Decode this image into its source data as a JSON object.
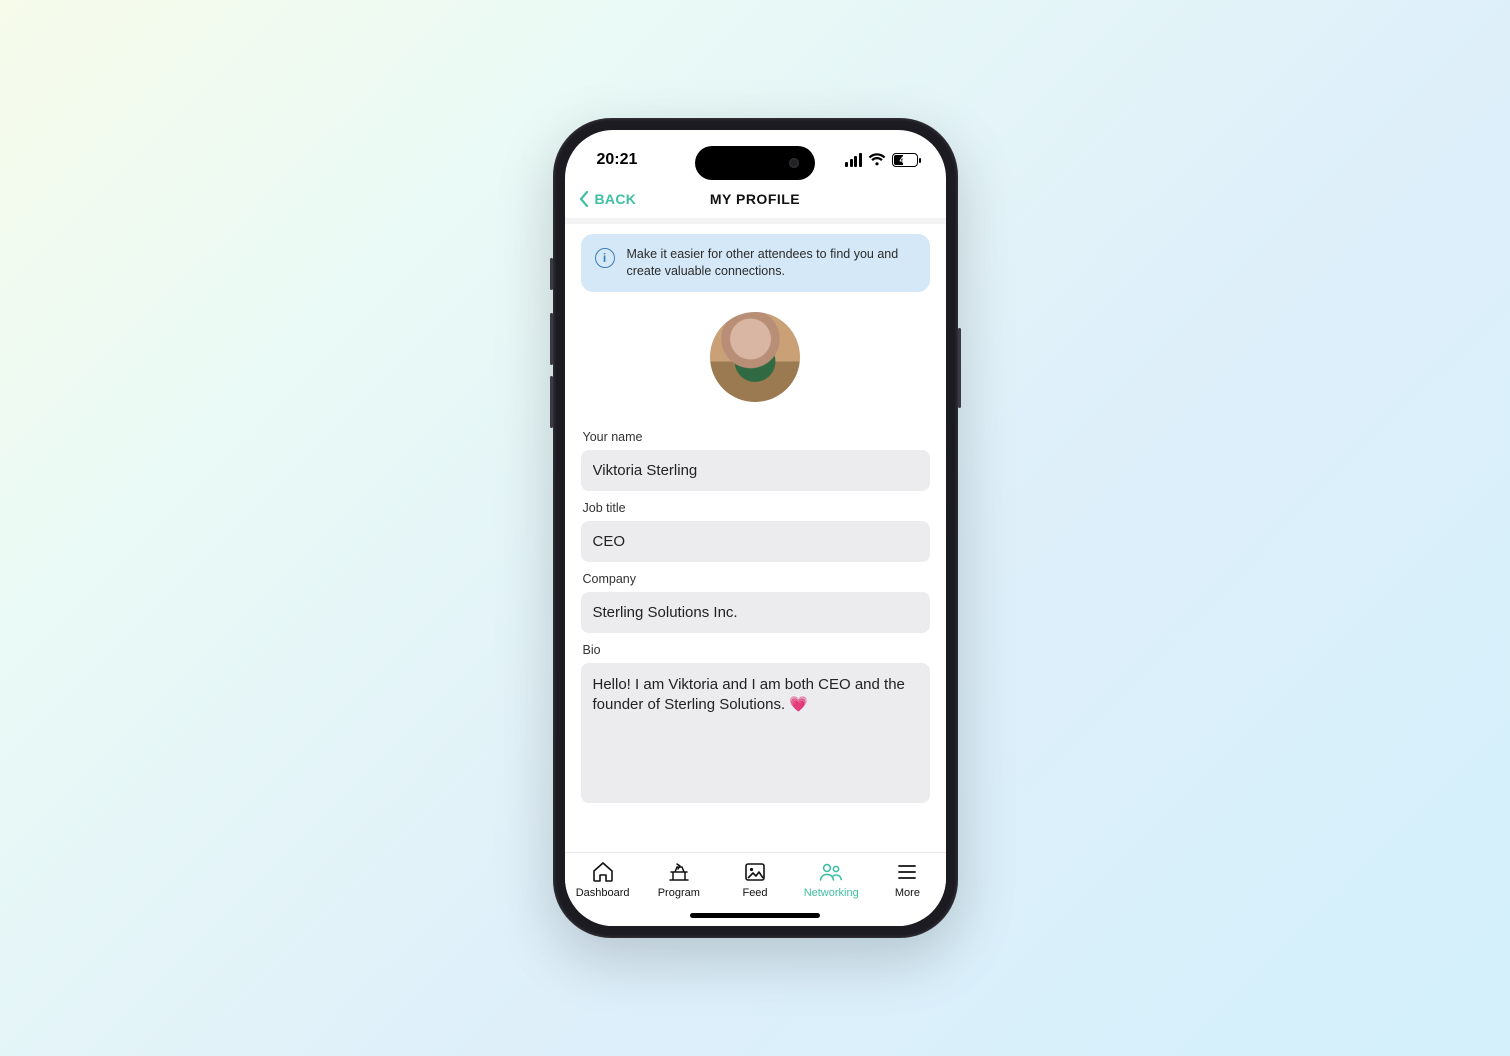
{
  "status": {
    "time": "20:21",
    "battery": "44"
  },
  "nav": {
    "back": "BACK",
    "title": "MY PROFILE"
  },
  "banner": {
    "text": "Make it easier for other attendees to find you and create valuable connections."
  },
  "form": {
    "name_label": "Your name",
    "name_value": "Viktoria Sterling",
    "job_label": "Job title",
    "job_value": "CEO",
    "company_label": "Company",
    "company_value": "Sterling Solutions Inc.",
    "bio_label": "Bio",
    "bio_value": "Hello! I am Viktoria and I am both CEO and the founder of Sterling Solutions. 💗"
  },
  "tabs": {
    "dashboard": "Dashboard",
    "program": "Program",
    "feed": "Feed",
    "networking": "Networking",
    "more": "More"
  },
  "colors": {
    "accent": "#3fbfa3",
    "banner_bg": "#d5e8f7",
    "input_bg": "#ececee"
  }
}
